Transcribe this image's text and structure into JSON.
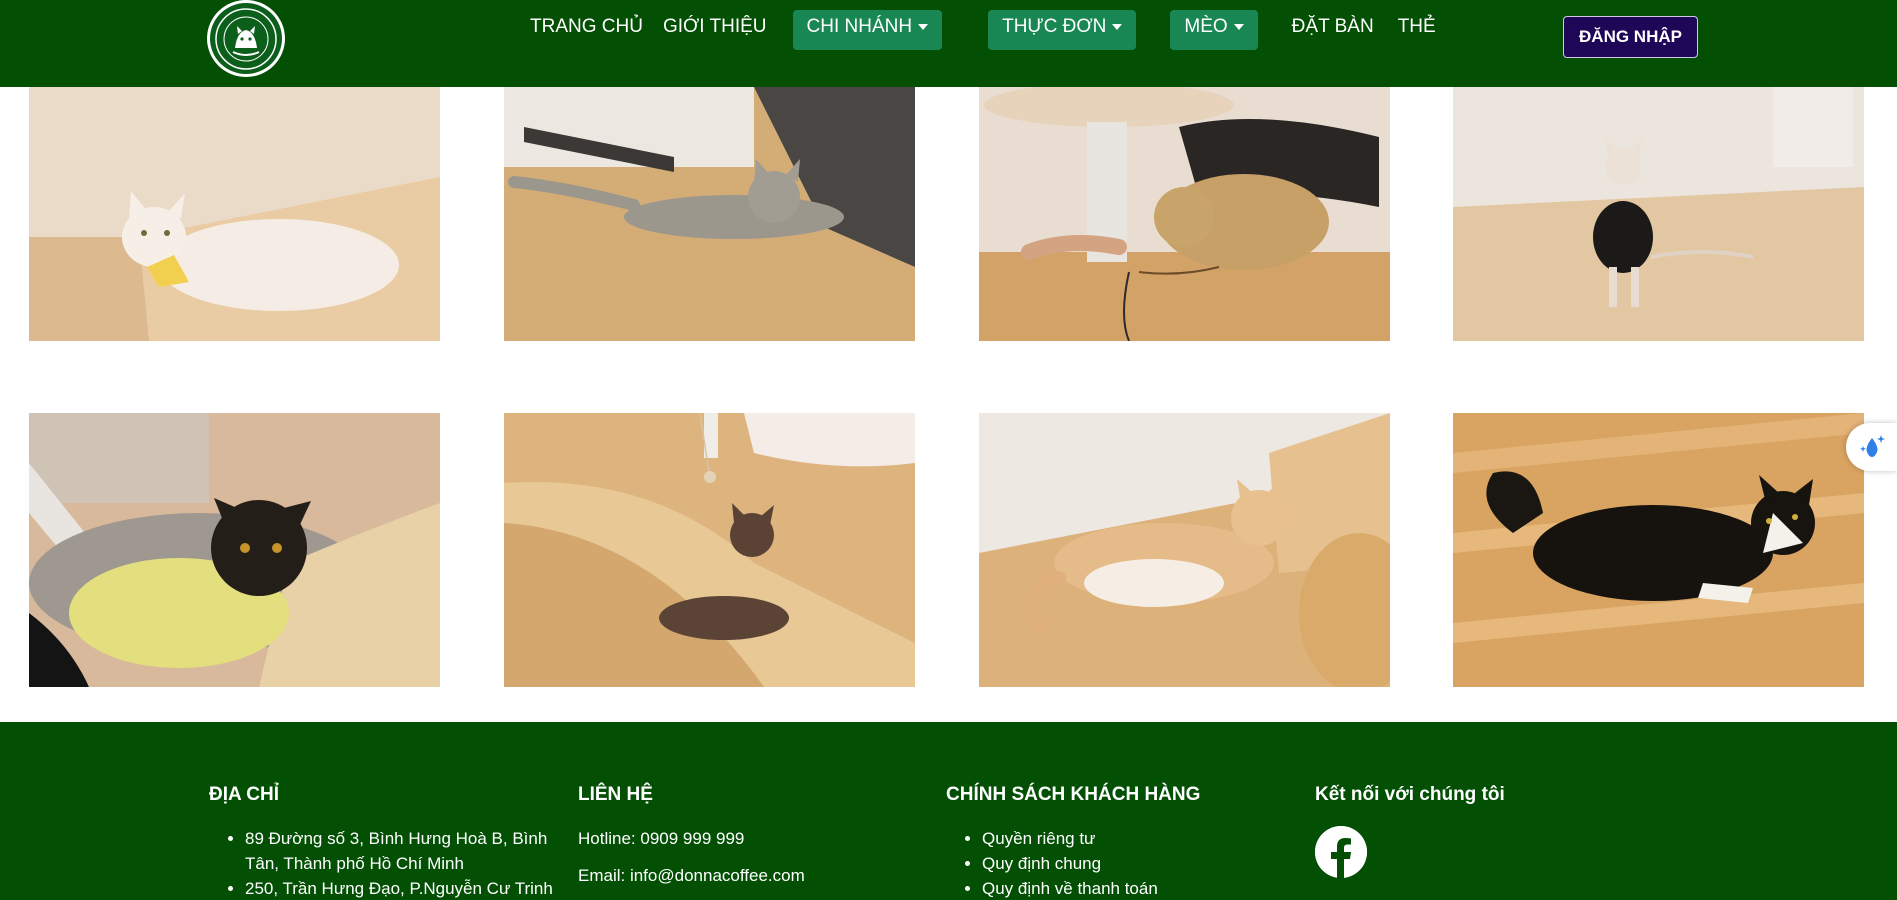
{
  "header": {
    "nav": [
      {
        "label": "TRANG CHỦ",
        "dropdown": false
      },
      {
        "label": "GIỚI THIỆU",
        "dropdown": false
      },
      {
        "label": "CHI NHÁNH",
        "dropdown": true
      },
      {
        "label": "THỰC ĐƠN",
        "dropdown": true
      },
      {
        "label": "MÈO",
        "dropdown": true
      },
      {
        "label": "ĐẶT BÀN",
        "dropdown": false
      },
      {
        "label": "THẺ",
        "dropdown": false
      }
    ],
    "login_label": "ĐĂNG NHẬP",
    "logo_icon": "cat-coffee-logo",
    "colors": {
      "header_bg": "#035005",
      "dropdown_bg": "#198754",
      "login_bg": "#1f0758"
    }
  },
  "gallery": {
    "photos": [
      {
        "name": "white-fluffy-cat-with-bow",
        "bg": "#e9d6be",
        "floor": "#ddb98e",
        "cat": "#f4ece4"
      },
      {
        "name": "silver-tabby-cat-lying",
        "bg": "#c9a26b",
        "floor": "#d9b27a",
        "cat": "#9a968c"
      },
      {
        "name": "golden-cat-playing",
        "bg": "#e7dbd0",
        "floor": "#d3a46a",
        "cat": "#c9a46a"
      },
      {
        "name": "sphynx-cat-in-vest",
        "bg": "#ebe3dc",
        "floor": "#e0c49f",
        "cat": "#e8dcd0"
      },
      {
        "name": "black-cat-in-yellow-shirt",
        "bg": "#b0a69a",
        "floor": "#e7cfa0",
        "cat": "#1e1a16"
      },
      {
        "name": "brown-cat-lying",
        "bg": "#e6c493",
        "floor": "#dab27c",
        "cat": "#5b4436"
      },
      {
        "name": "orange-white-cat-lying",
        "bg": "#ece7e0",
        "floor": "#dcb27a",
        "cat": "#e3b98a"
      },
      {
        "name": "black-white-longhair-cat",
        "bg": "#dcaa6c",
        "floor": "#d9a462",
        "cat": "#15120f"
      }
    ]
  },
  "footer": {
    "address": {
      "title": "ĐỊA CHỈ",
      "items": [
        "89 Đường số 3, Bình Hưng Hoà B, Bình Tân, Thành phố Hồ Chí Minh",
        "250, Trần Hưng Đạo, P.Nguyễn Cư Trinh"
      ]
    },
    "contact": {
      "title": "LIÊN HỆ",
      "hotline": "Hotline: 0909 999 999",
      "email": "Email: info@donnacoffee.com"
    },
    "policy": {
      "title": "CHÍNH SÁCH KHÁCH HÀNG",
      "items": [
        "Quyền riêng tư",
        "Quy định chung",
        "Quy định về thanh toán"
      ]
    },
    "social": {
      "title": "Kết nối với chúng tôi",
      "icon": "facebook-icon"
    }
  }
}
